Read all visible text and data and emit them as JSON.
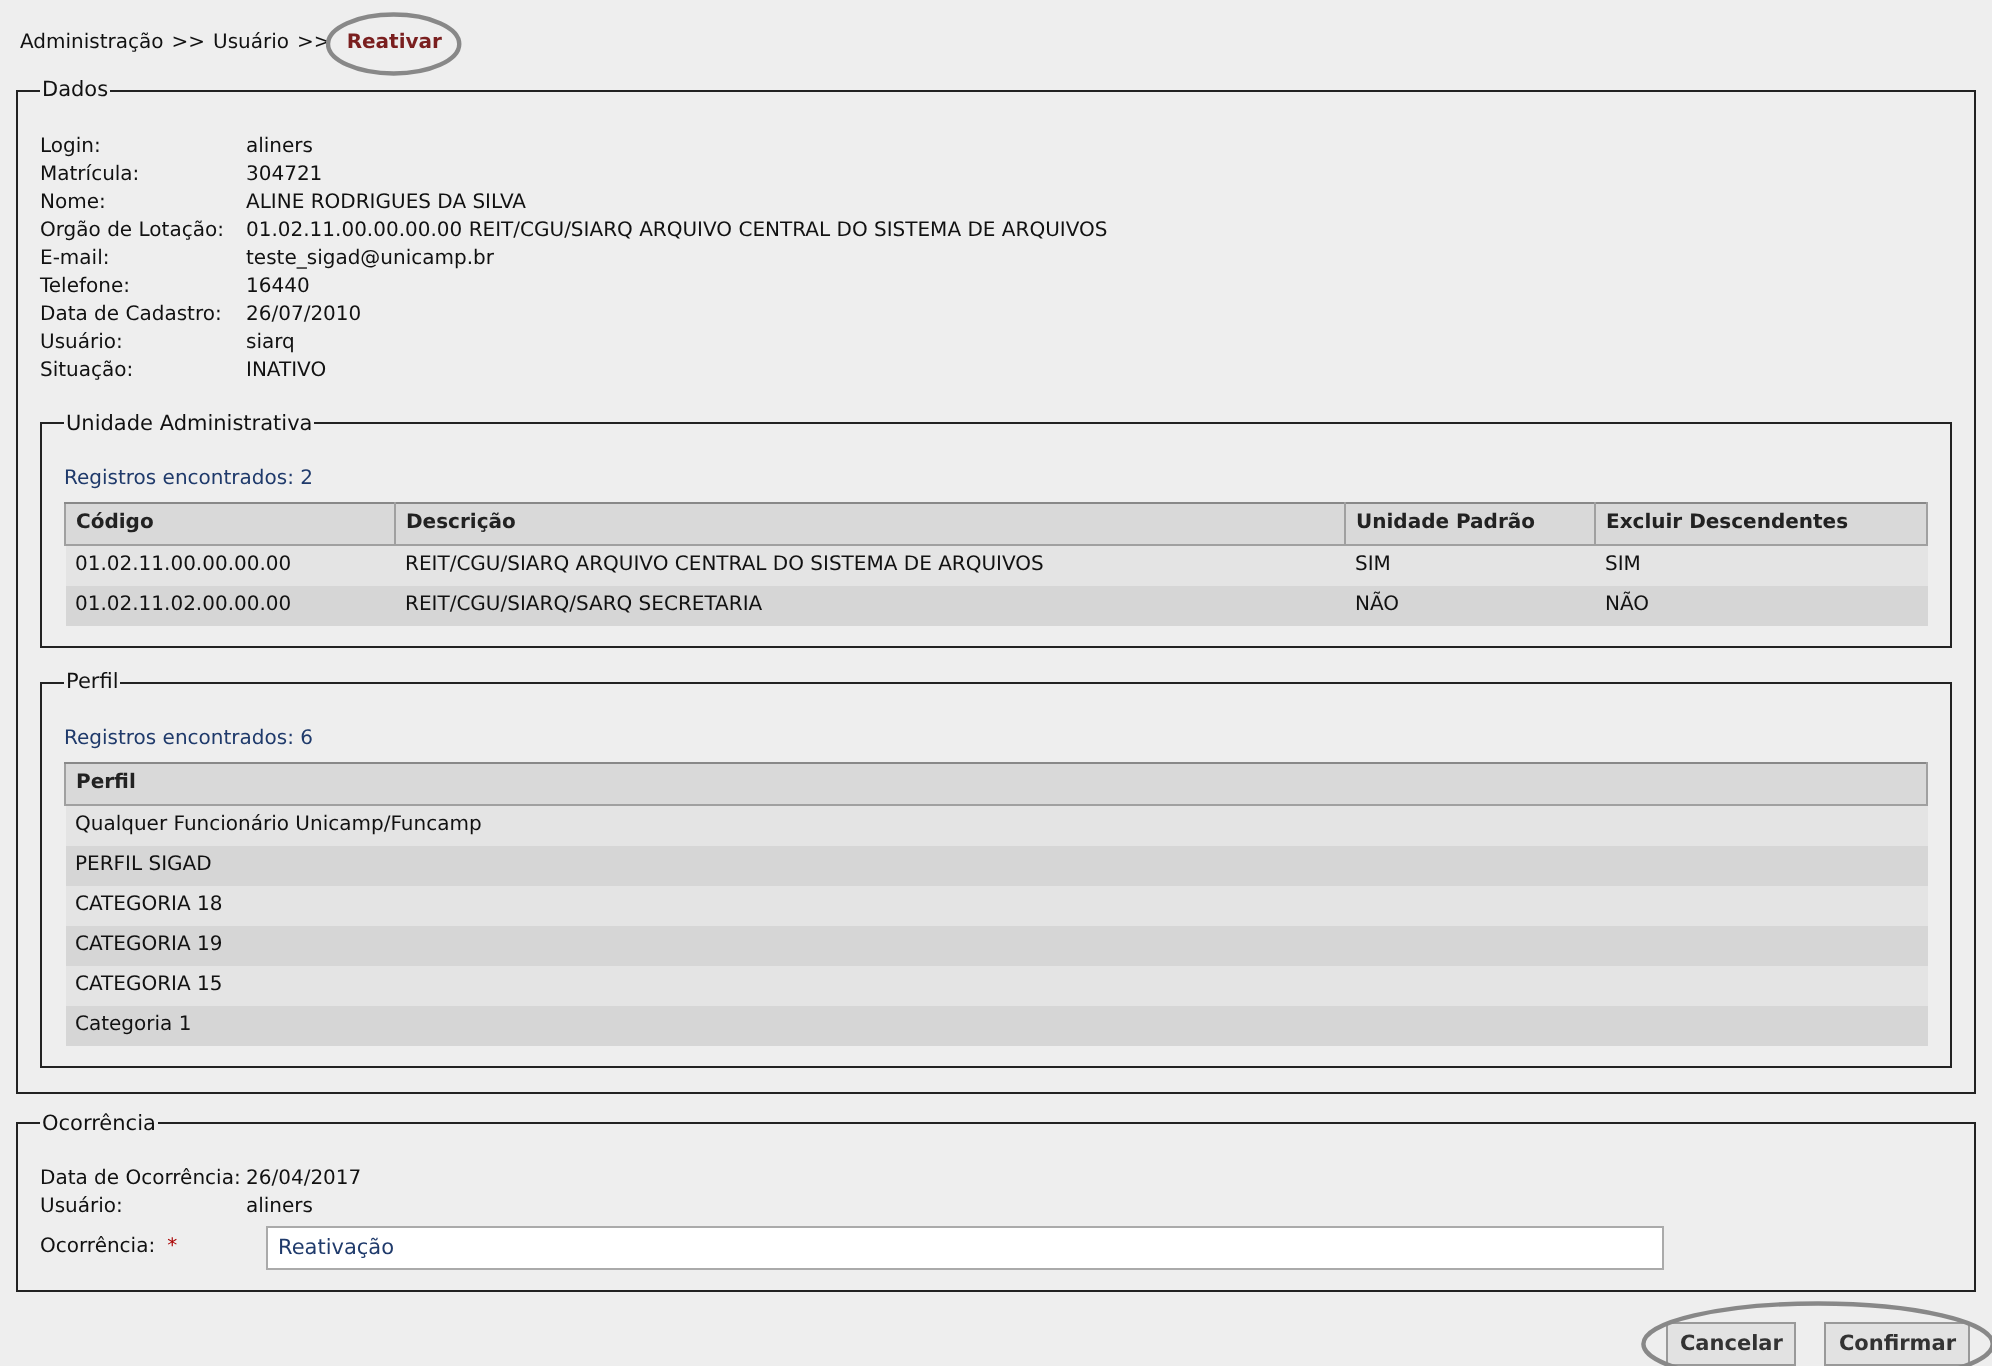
{
  "breadcrumb": [
    {
      "kind": "link",
      "text": "Administração",
      "circled": false
    },
    {
      "kind": "separator",
      "text": ">>",
      "circled": false
    },
    {
      "kind": "link",
      "text": "Usuário",
      "circled": false
    },
    {
      "kind": "separator",
      "text": ">>",
      "circled": false
    },
    {
      "kind": "current",
      "text": "Reativar",
      "circled": true
    }
  ],
  "dados": {
    "legend": "Dados",
    "fields": [
      {
        "label": "Login:",
        "value": "aliners"
      },
      {
        "label": "Matrícula:",
        "value": "304721"
      },
      {
        "label": "Nome:",
        "value": "ALINE RODRIGUES DA SILVA"
      },
      {
        "label": "Orgão de Lotação:",
        "value": "01.02.11.00.00.00.00 REIT/CGU/SIARQ ARQUIVO CENTRAL DO SISTEMA DE ARQUIVOS"
      },
      {
        "label": "E-mail:",
        "value": "teste_sigad@unicamp.br"
      },
      {
        "label": "Telefone:",
        "value": "16440"
      },
      {
        "label": "Data de Cadastro:",
        "value": "26/07/2010"
      },
      {
        "label": "Usuário:",
        "value": "siarq"
      },
      {
        "label": "Situação:",
        "value": "INATIVO"
      }
    ],
    "sections": [
      {
        "legend": "Unidade Administrativa",
        "count": "Registros encontrados: 2",
        "columns": [
          "Código",
          "Descrição",
          "Unidade Padrão",
          "Excluir Descendentes"
        ],
        "rows": [
          [
            "01.02.11.00.00.00.00",
            "REIT/CGU/SIARQ ARQUIVO CENTRAL DO SISTEMA DE ARQUIVOS",
            "SIM",
            "SIM"
          ],
          [
            "01.02.11.02.00.00.00",
            "REIT/CGU/SIARQ/SARQ SECRETARIA",
            "NÃO",
            "NÃO"
          ]
        ]
      },
      {
        "legend": "Perfil",
        "count": "Registros encontrados: 6",
        "columns": [
          "Perfil"
        ],
        "rows": [
          [
            "Qualquer Funcionário Unicamp/Funcamp"
          ],
          [
            "PERFIL SIGAD"
          ],
          [
            "CATEGORIA 18"
          ],
          [
            "CATEGORIA 19"
          ],
          [
            "CATEGORIA 15"
          ],
          [
            "Categoria 1"
          ]
        ]
      }
    ]
  },
  "ocorrencia": {
    "legend": "Ocorrência",
    "fields": [
      {
        "label": "Data de Ocorrência:",
        "value": "26/04/2017"
      },
      {
        "label": "Usuário:",
        "value": "aliners"
      }
    ],
    "input": {
      "label": "Ocorrência:",
      "required_mark": "*",
      "value": "Reativação"
    }
  },
  "actions": {
    "circled": true,
    "buttons": [
      "Cancelar",
      "Confirmar"
    ]
  }
}
